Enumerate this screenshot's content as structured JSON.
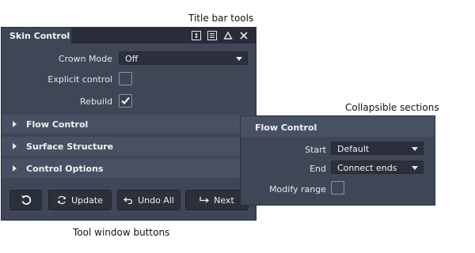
{
  "callouts": {
    "title_bar_tools": "Title bar tools",
    "collapsible_sections": "Collapsible sections",
    "tool_window_buttons": "Tool window buttons"
  },
  "window": {
    "title": "Skin Control",
    "title_icons": [
      "resize-icon",
      "menu-icon",
      "collapse-icon",
      "close-icon"
    ]
  },
  "fields": {
    "crown_mode": {
      "label": "Crown Mode",
      "value": "Off"
    },
    "explicit_control": {
      "label": "Explicit control",
      "checked": false
    },
    "rebuild": {
      "label": "Rebuild",
      "checked": true
    }
  },
  "sections": [
    {
      "label": "Flow Control",
      "expanded": false
    },
    {
      "label": "Surface Structure",
      "expanded": false
    },
    {
      "label": "Control Options",
      "expanded": false
    }
  ],
  "buttons": {
    "reset_icon": "reset-icon",
    "update": "Update",
    "undo_all": "Undo All",
    "next": "Next"
  },
  "flow_panel": {
    "title": "Flow Control",
    "start": {
      "label": "Start",
      "value": "Default"
    },
    "end": {
      "label": "End",
      "value": "Connect ends"
    },
    "modify_range": {
      "label": "Modify range",
      "checked": false
    }
  },
  "colors": {
    "panel_bg": "#3f4757",
    "section_bg": "#485163",
    "title_bar_bg": "#272c36",
    "field_bg": "#2b303b",
    "text": "#e6e8ec"
  }
}
